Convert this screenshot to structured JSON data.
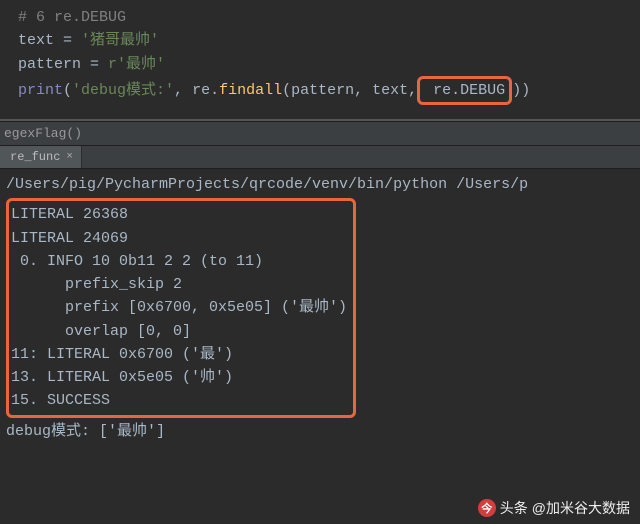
{
  "editor": {
    "comment": "# 6 re.DEBUG",
    "line2_var": "text",
    "line2_eq": " = ",
    "line2_str": "'猪哥最帅'",
    "line3_var": "pattern",
    "line3_eq": " = ",
    "line3_prefix": "r",
    "line3_str": "'最帅'",
    "line4_print": "print",
    "line4_open": "(",
    "line4_arg1": "'debug模式:'",
    "line4_comma1": ", ",
    "line4_re": "re",
    "line4_dot": ".",
    "line4_findall": "findall",
    "line4_args": "(pattern, text,",
    "line4_debug_pre": " re",
    "line4_debug_dot": ".",
    "line4_debug": "DEBUG",
    "line4_close": "))"
  },
  "breadcrumb": {
    "text": "egexFlag()"
  },
  "tab": {
    "label": "re_func",
    "close": "×"
  },
  "console": {
    "path": "/Users/pig/PycharmProjects/qrcode/venv/bin/python /Users/p",
    "lines": {
      "l0": "LITERAL 26368",
      "l1": "LITERAL 24069",
      "l2": "",
      "l3": " 0. INFO 10 0b11 2 2 (to 11)",
      "l4": "      prefix_skip 2",
      "l5": "      prefix [0x6700, 0x5e05] ('最帅')",
      "l6": "      overlap [0, 0]",
      "l7": "11: LITERAL 0x6700 ('最')",
      "l8": "13. LITERAL 0x5e05 ('帅')",
      "l9": "15. SUCCESS"
    },
    "result": "debug模式: ['最帅']"
  },
  "watermark": {
    "label": "头条",
    "author": "@加米谷大数据"
  }
}
